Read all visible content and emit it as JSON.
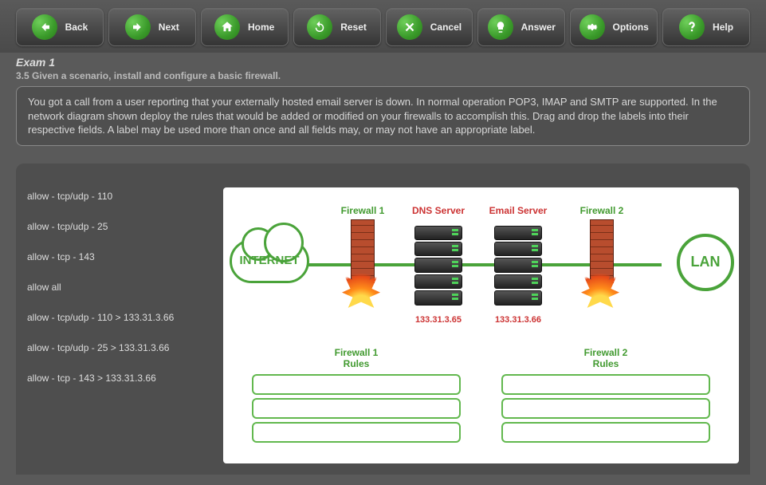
{
  "toolbar": {
    "back": {
      "label": "Back",
      "icon": "arrow-left"
    },
    "next": {
      "label": "Next",
      "icon": "arrow-right"
    },
    "home": {
      "label": "Home",
      "icon": "home"
    },
    "reset": {
      "label": "Reset",
      "icon": "refresh"
    },
    "cancel": {
      "label": "Cancel",
      "icon": "x"
    },
    "answer": {
      "label": "Answer",
      "icon": "bulb"
    },
    "options": {
      "label": "Options",
      "icon": "gear"
    },
    "help": {
      "label": "Help",
      "icon": "question"
    }
  },
  "header": {
    "exam_title": "Exam 1",
    "objective": "3.5 Given a scenario, install and configure a basic firewall.",
    "scenario": "You got a call from a user reporting that your externally hosted email server is down. In normal operation POP3, IMAP and SMTP are supported. In the network diagram shown deploy the rules that would be added or modified on your firewalls to accomplish this. Drag and drop the labels into their respective fields. A label may be used more than once and all fields may, or may not have an appropriate label."
  },
  "drag_labels": [
    "allow - tcp/udp - 110",
    "allow - tcp/udp - 25",
    "allow - tcp - 143",
    "allow all",
    "allow - tcp/udp - 110 > 133.31.3.66",
    "allow - tcp/udp - 25 > 133.31.3.66",
    "allow - tcp - 143 > 133.31.3.66"
  ],
  "diagram": {
    "internet_label": "INTERNET",
    "lan_label": "LAN",
    "firewall1_label": "Firewall 1",
    "firewall2_label": "Firewall 2",
    "dns_label": "DNS Server",
    "email_label": "Email Server",
    "dns_ip": "133.31.3.65",
    "email_ip": "133.31.3.66",
    "rules1_title": "Firewall 1 Rules",
    "rules2_title": "Firewall 2 Rules"
  }
}
